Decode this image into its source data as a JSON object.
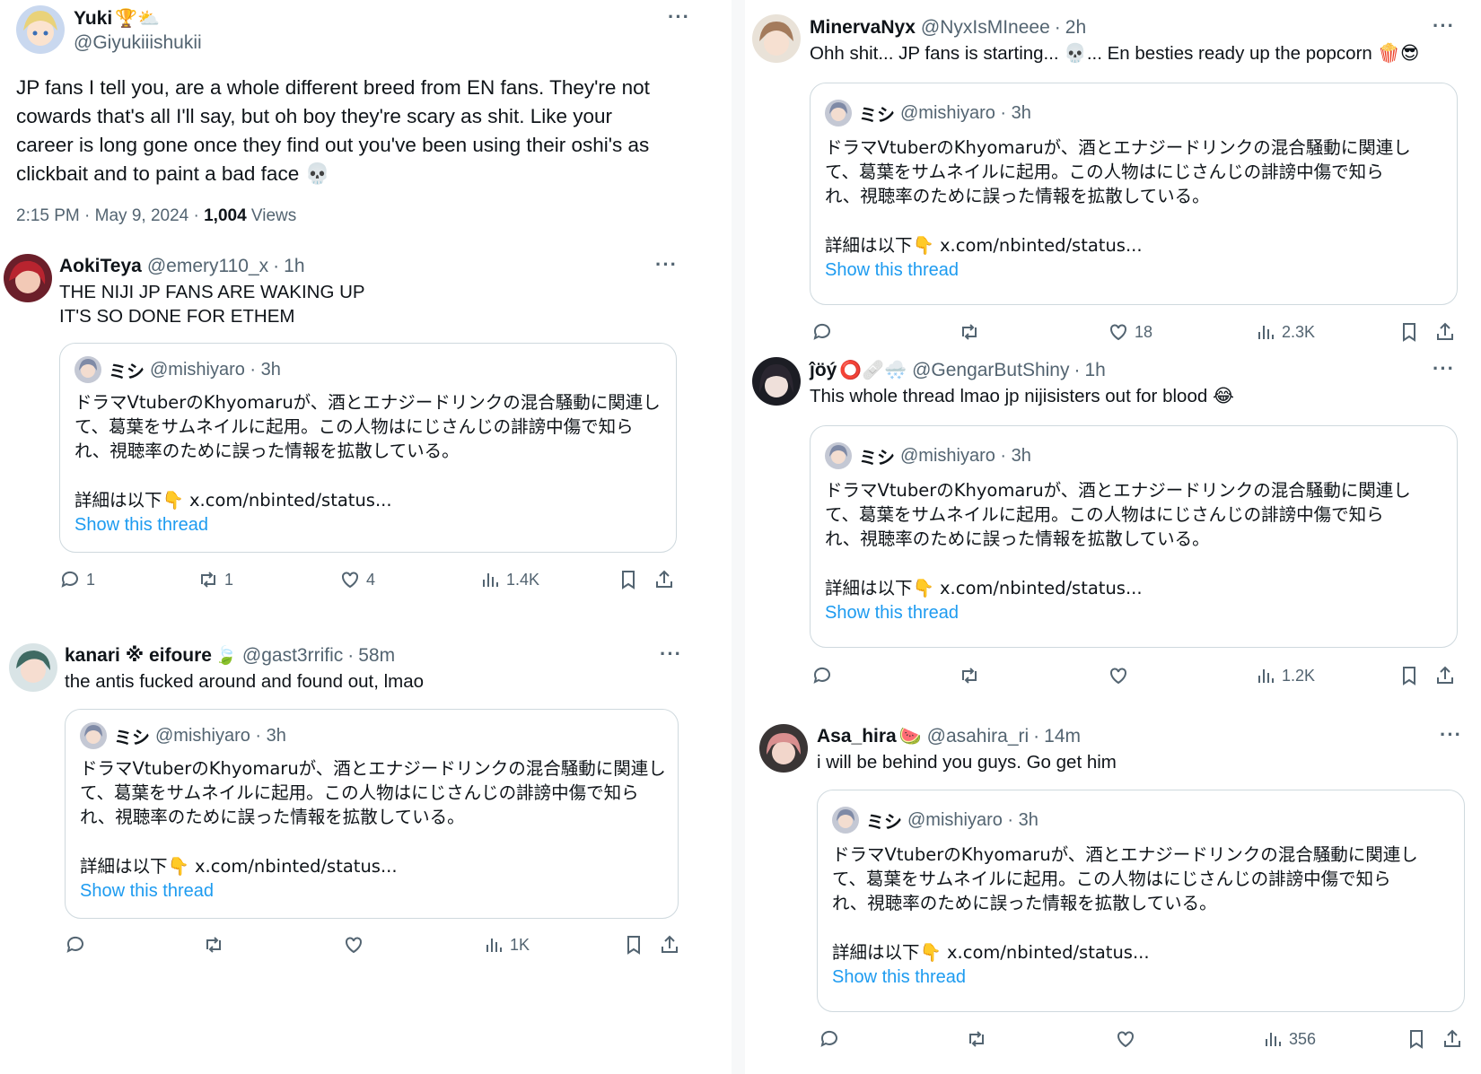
{
  "main_tweet": {
    "display_name": "Yuki",
    "emoji": "🏆⛅",
    "handle": "@Giyukiiishukii",
    "more": "···",
    "lines": [
      "JP fans I tell you, are a whole different breed from EN fans. They're not",
      "cowards that's all I'll say, but oh boy they're scary as shit. Like your",
      "career is long gone once they find out you've been using their oshi's as",
      "clickbait and to paint a bad face 💀"
    ],
    "timestamp": "2:15 PM · May 9, 2024 · ",
    "views_count": "1,004",
    "views_label": " Views"
  },
  "quote": {
    "name": "ミシ",
    "handle": "@mishiyaro · 3h",
    "lines": [
      "ドラマVtuberのKhyomaruが、酒とエナジードリンクの混合騒動に関連し",
      "て、葛葉をサムネイルに起用。この人物はにじさんじの誹謗中傷で知ら",
      "れ、視聴率のために誤った情報を拡散している。"
    ],
    "details": "詳細は以下👇 x.com/nbinted/status...",
    "show_thread": "Show this thread"
  },
  "replies_left": [
    {
      "display_name": "AokiTeya",
      "emoji": "",
      "handle": "@emery110_x",
      "dot": "·",
      "time": "1h",
      "more": "···",
      "lines": [
        "THE NIJI JP FANS ARE WAKING UP",
        "IT'S SO DONE FOR ETHEM"
      ],
      "counts": {
        "reply": "1",
        "retweet": "1",
        "like": "4",
        "views": "1.4K"
      }
    },
    {
      "display_name": "kanari ※ eifoure",
      "emoji": "🍃",
      "handle": "@gast3rrific",
      "dot": "·",
      "time": "58m",
      "more": "···",
      "lines": [
        "the antis fucked around and found out, lmao"
      ],
      "counts": {
        "reply": "",
        "retweet": "",
        "like": "",
        "views": "1K"
      }
    }
  ],
  "replies_right": [
    {
      "display_name": "MinervaNyx",
      "emoji": "",
      "handle": "@NyxIsMIneee",
      "dot": "·",
      "time": "2h",
      "more": "···",
      "lines": [
        "Ohh shit... JP fans is starting... 💀... En besties ready up the popcorn 🍿😎"
      ],
      "counts": {
        "reply": "",
        "retweet": "",
        "like": "18",
        "views": "2.3K"
      }
    },
    {
      "display_name": "ĵöý",
      "emoji": "⭕🩹🌨️",
      "handle": "@GengarButShiny",
      "dot": "·",
      "time": "1h",
      "more": "···",
      "lines": [
        "This whole thread lmao jp nijisisters out for blood 😂"
      ],
      "counts": {
        "reply": "",
        "retweet": "",
        "like": "",
        "views": "1.2K"
      }
    },
    {
      "display_name": "Asa_hira",
      "emoji": "🍉",
      "handle": "@asahira_ri",
      "dot": "·",
      "time": "14m",
      "more": "···",
      "lines": [
        "i will be behind you guys. Go get him"
      ],
      "counts": {
        "reply": "",
        "retweet": "",
        "like": "",
        "views": "356"
      }
    }
  ],
  "icons": [
    "reply-icon",
    "retweet-icon",
    "like-icon",
    "views-icon",
    "bookmark-icon",
    "share-icon"
  ],
  "colors": {
    "link": "#1d9bf0",
    "secondary_text": "#536471",
    "border": "#cfd9de"
  }
}
